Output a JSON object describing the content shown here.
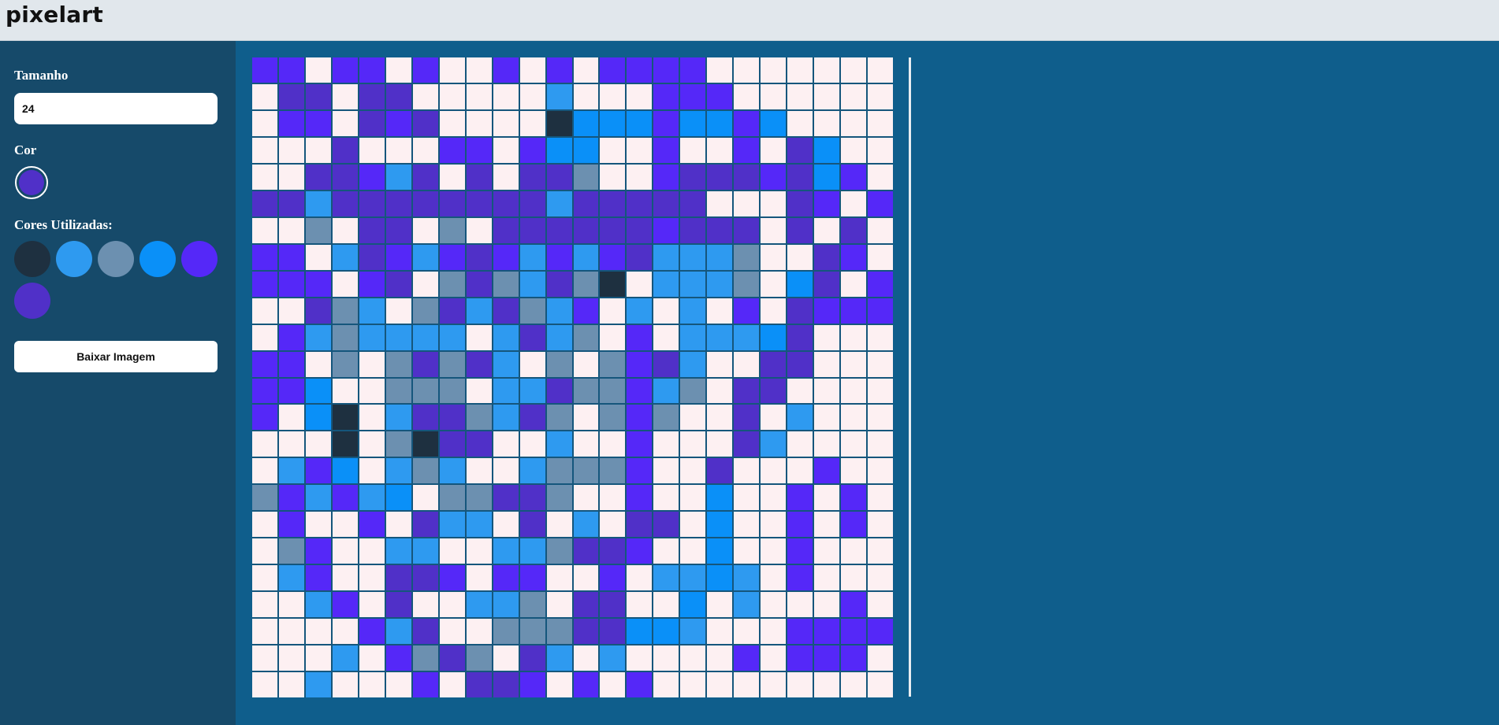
{
  "header": {
    "title": "pixelart"
  },
  "sidebar": {
    "size_label": "Tamanho",
    "size_value": "24",
    "color_label": "Cor",
    "current_color": "#5030c8",
    "used_colors_label": "Cores Utilizadas:",
    "used_colors": [
      "#1e3040",
      "#2e9af0",
      "#6c90b0",
      "#0a90f8",
      "#5528f8",
      "#5030c8"
    ],
    "download_label": "Baixar Imagem"
  },
  "grid": {
    "size": 24,
    "palette": {
      "W": "#fdf0f2",
      "V": "#5528f8",
      "P": "#5030c8",
      "L": "#2e9af0",
      "B": "#0a90f8",
      "G": "#6c90b0",
      "D": "#1e3040"
    },
    "rows": [
      "VVWVVWVWWVWVWVVVVWWWWWWW",
      "WPPWPPWWWWWLWWWVVVWWWWWW",
      "WVVWPVPWWWWDBBBVBBVBWWWW",
      "WWWPWWWVVWVBBWWVWWVWPBWW",
      "WWPPVLPWPWPPGWWVPPPVPBVW",
      "PPLPPPPPPPPLPPPPPWWWPVWV",
      "WWGWPPWGWPPPPPPVPPPWPWPW",
      "VVWLPVLVPVLVLVPLLLGWWPVW",
      "VVVWVPWGPGLPGDWLLLGWBPWV",
      "WWPGLWGPLPGLVWLWLWVWPVVV",
      "WVLGLLLLWLPLGWVWLLLBPWWW",
      "VVWGWGPGPLWGWGVPLWWPPWWW",
      "VVBWWGGGWLLPGGVLGWPPWWWW",
      "VWBDWLPPGLPGWGVGWWPWLWWW",
      "WWWDWGDPPWWLWWVWWWPLWWWW",
      "WLVBWLGLWWLGGGVWWPWWWVWW",
      "GVLVLBWGGPPGWWVWWBWWVWVW",
      "WVWWVWPLLWPWLWPPWBWWVWVW",
      "WGVWWLLWWLLGPPVWWBWWVWWW",
      "WLVWWPPVWVVWWVWLLBLWVWWW",
      "WWLVWPWWLLGWPPWWBWLWWWVW",
      "WWWWVLPWWGGGPPBBLWWWVVVV",
      "WWWLWVGPGWPLWLWWWWVWVVVW",
      "WWLWWWVWPPVWVWVWWWWWWWWW"
    ]
  }
}
